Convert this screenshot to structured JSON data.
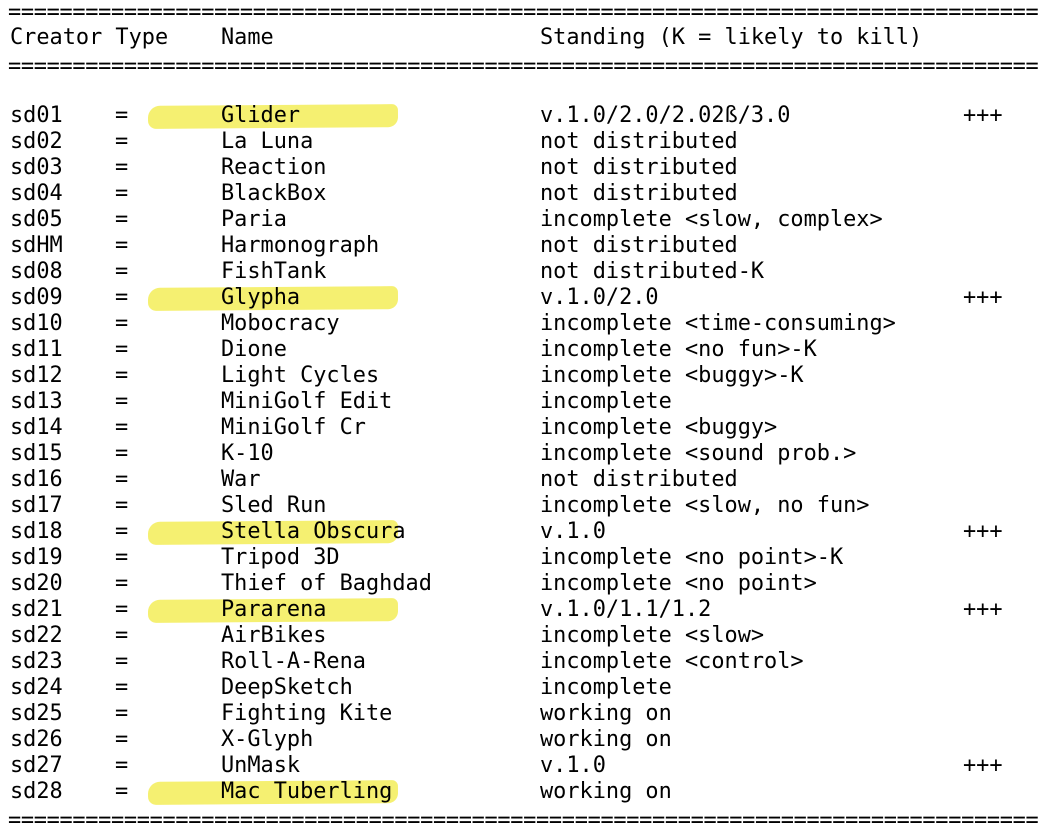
{
  "separator": "================================================================================",
  "header": {
    "creator_type": "Creator Type",
    "name": "Name",
    "standing": "Standing (K = likely to kill)"
  },
  "highlight_color": "#f4ee62",
  "rows": [
    {
      "id": "sd01",
      "type": "=",
      "name": "Glider",
      "standing": "v.1.0/2.0/2.02ß/3.0",
      "mark": "+++",
      "highlighted": true
    },
    {
      "id": "sd02",
      "type": "=",
      "name": "La Luna",
      "standing": "not distributed",
      "mark": "",
      "highlighted": false
    },
    {
      "id": "sd03",
      "type": "=",
      "name": "Reaction",
      "standing": "not distributed",
      "mark": "",
      "highlighted": false
    },
    {
      "id": "sd04",
      "type": "=",
      "name": "BlackBox",
      "standing": "not distributed",
      "mark": "",
      "highlighted": false
    },
    {
      "id": "sd05",
      "type": "=",
      "name": "Paria",
      "standing": "incomplete <slow, complex>",
      "mark": "",
      "highlighted": false
    },
    {
      "id": "sdHM",
      "type": "=",
      "name": "Harmonograph",
      "standing": "not distributed",
      "mark": "",
      "highlighted": false
    },
    {
      "id": "sd08",
      "type": "=",
      "name": "FishTank",
      "standing": "not distributed-K",
      "mark": "",
      "highlighted": false
    },
    {
      "id": "sd09",
      "type": "=",
      "name": "Glypha",
      "standing": "v.1.0/2.0",
      "mark": "+++",
      "highlighted": true
    },
    {
      "id": "sd10",
      "type": "=",
      "name": "Mobocracy",
      "standing": "incomplete <time-consuming>",
      "mark": "",
      "highlighted": false
    },
    {
      "id": "sd11",
      "type": "=",
      "name": "Dione",
      "standing": "incomplete <no fun>-K",
      "mark": "",
      "highlighted": false
    },
    {
      "id": "sd12",
      "type": "=",
      "name": "Light Cycles",
      "standing": "incomplete <buggy>-K",
      "mark": "",
      "highlighted": false
    },
    {
      "id": "sd13",
      "type": "=",
      "name": "MiniGolf Edit",
      "standing": "incomplete",
      "mark": "",
      "highlighted": false
    },
    {
      "id": "sd14",
      "type": "=",
      "name": "MiniGolf Cr",
      "standing": "incomplete <buggy>",
      "mark": "",
      "highlighted": false
    },
    {
      "id": "sd15",
      "type": "=",
      "name": "K-10",
      "standing": "incomplete <sound prob.>",
      "mark": "",
      "highlighted": false
    },
    {
      "id": "sd16",
      "type": "=",
      "name": "War",
      "standing": "not distributed",
      "mark": "",
      "highlighted": false
    },
    {
      "id": "sd17",
      "type": "=",
      "name": "Sled Run",
      "standing": "incomplete <slow, no fun>",
      "mark": "",
      "highlighted": false
    },
    {
      "id": "sd18",
      "type": "=",
      "name": "Stella Obscura",
      "standing": "v.1.0",
      "mark": "+++",
      "highlighted": true
    },
    {
      "id": "sd19",
      "type": "=",
      "name": "Tripod 3D",
      "standing": "incomplete <no point>-K",
      "mark": "",
      "highlighted": false
    },
    {
      "id": "sd20",
      "type": "=",
      "name": "Thief of Baghdad",
      "standing": "incomplete <no point>",
      "mark": "",
      "highlighted": false
    },
    {
      "id": "sd21",
      "type": "=",
      "name": "Pararena",
      "standing": "v.1.0/1.1/1.2",
      "mark": "+++",
      "highlighted": true
    },
    {
      "id": "sd22",
      "type": "=",
      "name": "AirBikes",
      "standing": "incomplete <slow>",
      "mark": "",
      "highlighted": false
    },
    {
      "id": "sd23",
      "type": "=",
      "name": "Roll-A-Rena",
      "standing": "incomplete <control>",
      "mark": "",
      "highlighted": false
    },
    {
      "id": "sd24",
      "type": "=",
      "name": "DeepSketch",
      "standing": "incomplete",
      "mark": "",
      "highlighted": false
    },
    {
      "id": "sd25",
      "type": "=",
      "name": "Fighting Kite",
      "standing": "working on",
      "mark": "",
      "highlighted": false
    },
    {
      "id": "sd26",
      "type": "=",
      "name": "X-Glyph",
      "standing": "working on",
      "mark": "",
      "highlighted": false
    },
    {
      "id": "sd27",
      "type": "=",
      "name": "UnMask",
      "standing": "v.1.0",
      "mark": "+++",
      "highlighted": false
    },
    {
      "id": "sd28",
      "type": "=",
      "name": "Mac Tuberling",
      "standing": "working on",
      "mark": "",
      "highlighted": true
    }
  ]
}
